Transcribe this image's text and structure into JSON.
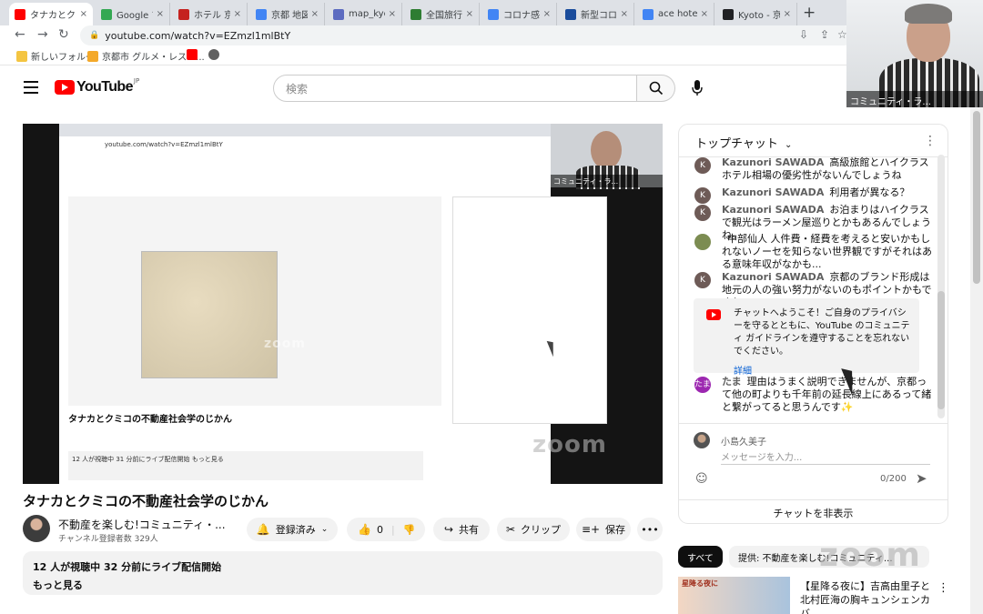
{
  "browser": {
    "tabs": [
      {
        "label": "タナカとクミコ",
        "color": "#ff0000",
        "active": true
      },
      {
        "label": "Google マ",
        "color": "#34a853",
        "active": false
      },
      {
        "label": "ホテル 京都",
        "color": "#c5221f",
        "active": false
      },
      {
        "label": "京都 地図",
        "color": "#4285f4",
        "active": false
      },
      {
        "label": "map_kyo",
        "color": "#5c6bc0",
        "active": false
      },
      {
        "label": "全国旅行",
        "color": "#2e7d32",
        "active": false
      },
      {
        "label": "コロナ感染",
        "color": "#4285f4",
        "active": false
      },
      {
        "label": "新型コロナ",
        "color": "#1a4c9c",
        "active": false
      },
      {
        "label": "ace hotel",
        "color": "#4285f4",
        "active": false
      },
      {
        "label": "Kyoto - 京",
        "color": "#202124",
        "active": false
      }
    ],
    "new_tab": "+",
    "url": "youtube.com/watch?v=EZmzl1mlBtY",
    "bookmarks": [
      {
        "label": "新しいフォルダ",
        "color": "#f4c542"
      },
      {
        "label": "京都市 グルメ・レスト...",
        "color": "#f4a92a"
      },
      {
        "label": "",
        "color": "#ff0000"
      },
      {
        "label": "",
        "color": "#606060"
      }
    ]
  },
  "youtube": {
    "logo_text": "YouTube",
    "logo_region": "JP",
    "search_placeholder": "検索"
  },
  "webcam": {
    "name": "コミュニティ・ラ..."
  },
  "video": {
    "nested_cam_name": "コミュニティ・ラ...",
    "inner_title": "タナカとクミコの不動産社会学のじかん",
    "inner_desc": "12 人が視聴中  31 分前にライブ配信開始  もっと見る",
    "watermark": "zoom"
  },
  "meta": {
    "title": "タナカとクミコの不動産社会学のじかん",
    "channel": "不動産を楽しむ!コミュニティ・...",
    "subscribers": "チャンネル登録者数 329人",
    "subscribe_label": "登録済み",
    "like_count": "0",
    "share_label": "共有",
    "clip_label": "クリップ",
    "save_label": "保存",
    "description_line1": "12 人が視聴中  32 分前にライブ配信開始",
    "description_more": "もっと見る"
  },
  "chat": {
    "header": "トップチャット",
    "messages": [
      {
        "initial": "K",
        "author": "Kazunori SAWADA",
        "text": "高級旅館とハイクラスホテル相場の優劣性がないんでしょうね",
        "color": "#6e5b57"
      },
      {
        "initial": "K",
        "author": "Kazunori SAWADA",
        "text": "利用者が異なる？",
        "color": "#6e5b57"
      },
      {
        "initial": "K",
        "author": "Kazunori SAWADA",
        "text": "お泊まりはハイクラスで観光はラーメン屋巡りとかもあるんでしょうね。",
        "color": "#6e5b57"
      },
      {
        "initial": "",
        "author": "",
        "text": "中部仙人 人件費・経費を考えると安いかもしれないノーセを知らない世界観ですがそれはある意味年収がなかも...",
        "color": "#7c8c52"
      },
      {
        "initial": "K",
        "author": "Kazunori SAWADA",
        "text": "京都のブランド形成は地元の人の強い努力がないのもポイントかもですね。",
        "color": "#6e5b57"
      },
      {
        "initial": "たま",
        "author": "たま",
        "text": "理由はうまく説明できませんが、京都って他の町よりも千年前の延長線上にあるって緒と繋がってると思うんです✨",
        "color": "#9c27b0"
      }
    ],
    "notice_text": "チャットへようこそ！ご自身のプライバシーを守るとともに、YouTube のコミュニティ ガイドラインを遵守することを忘れないでください。",
    "notice_more": "詳細",
    "user_name": "小島久美子",
    "input_placeholder": "メッセージを入力...",
    "counter": "0/200",
    "hide_label": "チャットを非表示"
  },
  "recommendations": {
    "chips": [
      "すべて",
      "提供: 不動産を楽しむ!コミュニティ..."
    ],
    "thumb_text": "星降る夜に",
    "item_title": "【星降る夜に】吉高由里子と北村匠海の胸キュンシェンカバ..."
  }
}
